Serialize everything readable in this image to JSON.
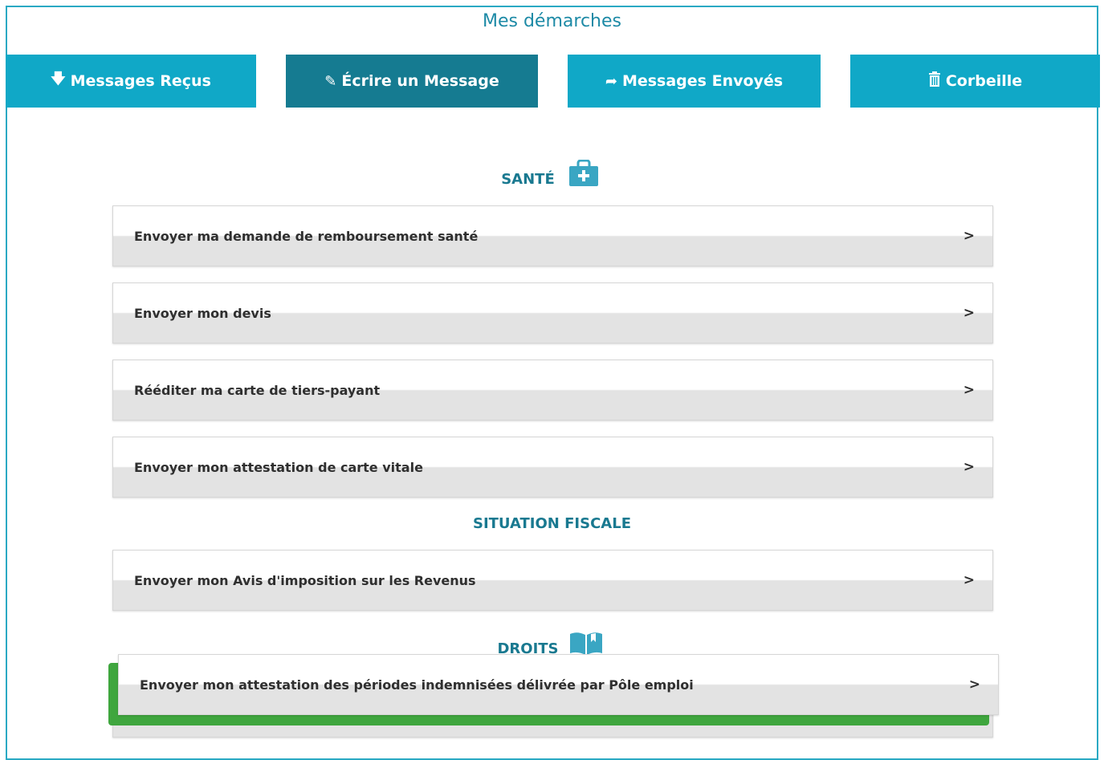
{
  "page": {
    "title": "Mes démarches"
  },
  "tabs": [
    {
      "label": "Messages Reçus",
      "icon": "arrow-down-icon"
    },
    {
      "label": "Écrire un Message",
      "icon": "pencil-icon",
      "active": true
    },
    {
      "label": "Messages Envoyés",
      "icon": "share-arrow-icon"
    },
    {
      "label": "Corbeille",
      "icon": "trash-icon"
    }
  ],
  "sections": [
    {
      "title": "SANTÉ",
      "icon": "medical-kit-icon",
      "items": [
        {
          "label": "Envoyer ma demande de remboursement santé",
          "chevron": ">"
        },
        {
          "label": "Envoyer mon devis",
          "chevron": ">"
        },
        {
          "label": "Rééditer ma carte de tiers-payant",
          "chevron": ">"
        },
        {
          "label": "Envoyer mon attestation de carte vitale",
          "chevron": ">"
        }
      ]
    },
    {
      "title": "SITUATION FISCALE",
      "items": [
        {
          "label": "Envoyer mon Avis d'imposition sur les Revenus",
          "chevron": ">"
        }
      ]
    },
    {
      "title": "DROITS",
      "icon": "book-icon",
      "items": [
        {
          "label": "Envoyer mon attestation des périodes indemnisées délivrée par Pôle emploi",
          "chevron": ">"
        }
      ]
    }
  ],
  "colors": {
    "accent": "#10a8c7",
    "active_tab": "#157b91",
    "highlight": "#3fa63e",
    "section_title": "#197990"
  }
}
